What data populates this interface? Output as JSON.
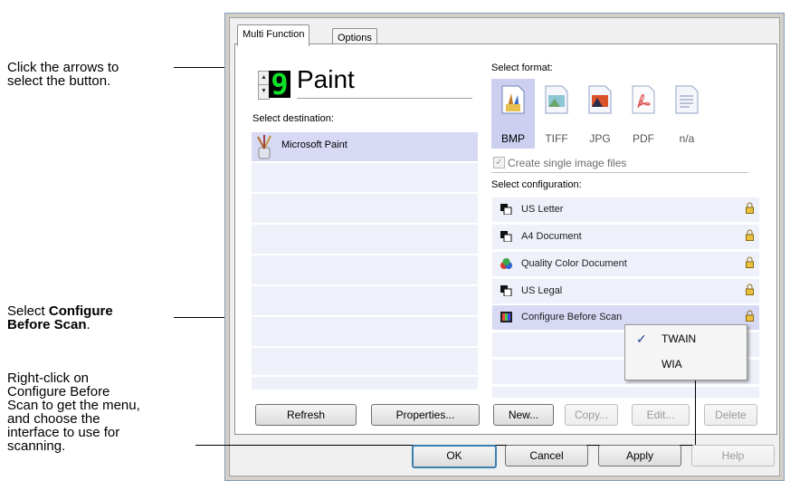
{
  "callouts": {
    "arrows": [
      "Click the arrows to",
      "select the button."
    ],
    "configure": {
      "pre": "Select ",
      "bold1": "Configure",
      "bold2": "Before Scan",
      "post": "."
    },
    "rightclick": [
      "Right-click on",
      "Configure Before",
      "Scan to get the menu,",
      "and choose the",
      "interface to use for",
      "scanning."
    ]
  },
  "tabs": [
    "Multi Function",
    "Options"
  ],
  "button_number": "9",
  "app_name": "Paint",
  "labels": {
    "select_destination": "Select destination:",
    "select_format": "Select format:",
    "create_single": "Create single image files",
    "select_configuration": "Select configuration:"
  },
  "destinations": [
    {
      "name": "Microsoft Paint",
      "icon": "paint-brushes-icon"
    }
  ],
  "formats": [
    {
      "label": "BMP",
      "icon": "bmp-icon",
      "selected": true
    },
    {
      "label": "TIFF",
      "icon": "tiff-icon",
      "selected": false
    },
    {
      "label": "JPG",
      "icon": "jpg-icon",
      "selected": false
    },
    {
      "label": "PDF",
      "icon": "pdf-icon",
      "selected": false
    },
    {
      "label": "n/a",
      "icon": "text-file-icon",
      "selected": false
    }
  ],
  "configurations": [
    {
      "name": "US Letter",
      "icon": "scanner-icon"
    },
    {
      "name": "A4 Document",
      "icon": "scanner-icon"
    },
    {
      "name": "Quality Color Document",
      "icon": "color-scanner-icon"
    },
    {
      "name": "US Legal",
      "icon": "scanner-icon"
    },
    {
      "name": "Configure Before Scan",
      "icon": "film-icon"
    }
  ],
  "context_menu": [
    {
      "label": "TWAIN",
      "checked": true
    },
    {
      "label": "WIA",
      "checked": false
    }
  ],
  "buttons": {
    "refresh": "Refresh",
    "properties": "Properties...",
    "new": "New...",
    "copy": "Copy...",
    "edit": "Edit...",
    "delete": "Delete",
    "ok": "OK",
    "cancel": "Cancel",
    "apply": "Apply",
    "help": "Help"
  },
  "colors": {
    "accent": "#cccff0",
    "row": "#eef0fa",
    "lcd_green": "#10e22a"
  }
}
